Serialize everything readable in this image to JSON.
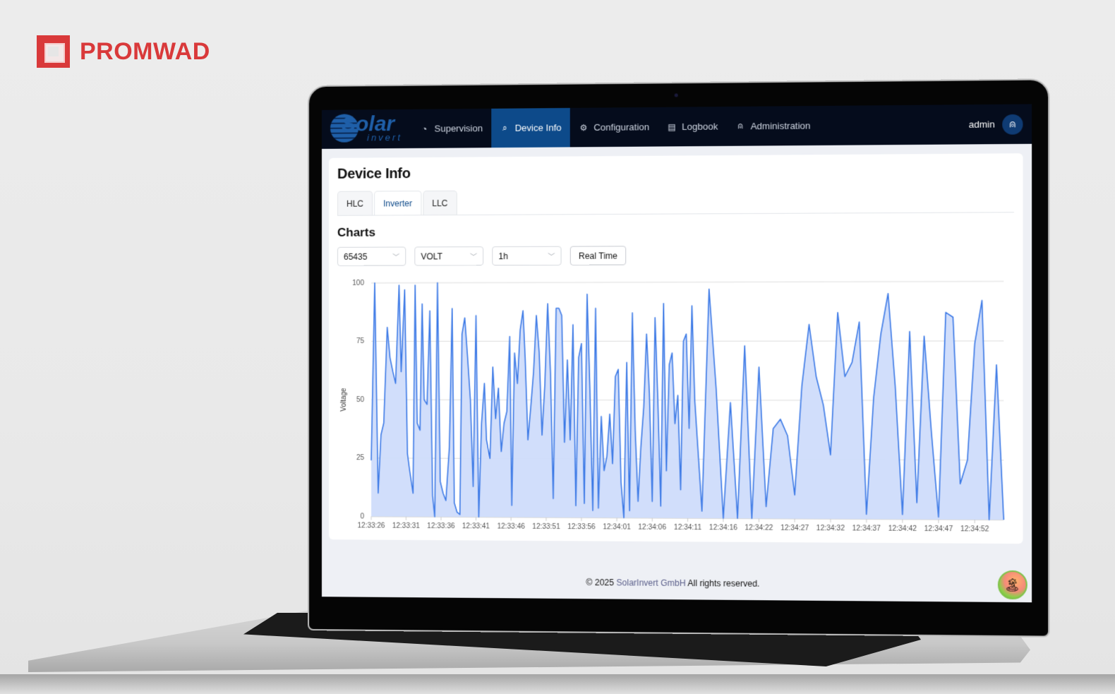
{
  "brand": {
    "name": "PROMWAD",
    "color": "#d9393a"
  },
  "app": {
    "logo": {
      "word": "Solar",
      "sub": "invert"
    },
    "nav": [
      {
        "label": "Supervision",
        "icon": "gauge-icon",
        "glyph": "◔",
        "active": false
      },
      {
        "label": "Device Info",
        "icon": "search-icon",
        "glyph": "⌕",
        "active": true
      },
      {
        "label": "Configuration",
        "icon": "gear-icon",
        "glyph": "⚙",
        "active": false
      },
      {
        "label": "Logbook",
        "icon": "logbook-icon",
        "glyph": "▤",
        "active": false
      },
      {
        "label": "Administration",
        "icon": "user-icon",
        "glyph": "⍝",
        "active": false
      }
    ],
    "user": {
      "name": "admin",
      "avatar_glyph": "⍝"
    },
    "colors": {
      "navbar": "#050c1c",
      "active_tab": "#0d4a8a",
      "series": "#3d7ae6",
      "fill": "#cfdcfb"
    }
  },
  "page": {
    "title": "Device Info",
    "tabs": [
      {
        "label": "HLC",
        "active": false
      },
      {
        "label": "Inverter",
        "active": true
      },
      {
        "label": "LLC",
        "active": false
      }
    ],
    "charts_title": "Charts",
    "controls": {
      "device": "65435",
      "metric": "VOLT",
      "range": "1h",
      "realtime_label": "Real Time"
    }
  },
  "chart_data": {
    "type": "area",
    "title": "",
    "xlabel": "",
    "ylabel": "Voltage",
    "ylim": [
      0,
      100
    ],
    "yticks": [
      0,
      25,
      50,
      75,
      100
    ],
    "grid": true,
    "legend": "none",
    "xtick_labels": [
      "12:33:26",
      "12:33:31",
      "12:33:36",
      "12:33:41",
      "12:33:46",
      "12:33:51",
      "12:33:56",
      "12:34:01",
      "12:34:06",
      "12:34:11",
      "12:34:16",
      "12:34:22",
      "12:34:27",
      "12:34:32",
      "12:34:37",
      "12:34:42",
      "12:34:47",
      "12:34:52"
    ],
    "x_start_s": 0,
    "x_end_s": 89,
    "tick_interval_s": 5,
    "series": [
      {
        "name": "Voltage",
        "t": [
          0,
          0.5,
          1,
          1.4,
          1.8,
          2.3,
          2.7,
          3.1,
          3.5,
          4,
          4.3,
          4.8,
          5.2,
          5.5,
          6,
          6.3,
          6.6,
          7,
          7.3,
          7.6,
          8,
          8.4,
          8.8,
          9.1,
          9.5,
          9.9,
          10.3,
          10.7,
          11.2,
          11.6,
          11.9,
          12.3,
          12.7,
          13,
          13.4,
          13.8,
          14.2,
          14.6,
          15,
          15.4,
          15.8,
          16.2,
          16.5,
          17,
          17.4,
          17.8,
          18.2,
          18.6,
          19,
          19.4,
          19.8,
          20.1,
          20.5,
          20.9,
          21.3,
          21.7,
          22,
          22.4,
          22.8,
          23.2,
          23.6,
          24,
          24.4,
          24.8,
          25.2,
          25.6,
          26,
          26.4,
          26.8,
          27.2,
          27.6,
          28,
          28.4,
          28.8,
          29.2,
          29.6,
          30,
          30.4,
          30.8,
          31.2,
          31.6,
          32,
          32.4,
          32.8,
          33.2,
          33.6,
          34,
          34.4,
          34.8,
          35.2,
          35.6,
          36,
          36.4,
          36.8,
          37.2,
          37.6,
          38,
          38.4,
          38.8,
          39.2,
          39.6,
          40,
          40.4,
          40.8,
          41.2,
          41.6,
          42,
          42.4,
          42.8,
          43.2,
          43.6,
          44,
          44.4,
          44.8,
          45.2,
          45.6,
          46,
          47,
          48,
          49,
          50,
          51,
          52,
          53,
          54,
          55,
          56,
          57,
          58,
          59,
          60,
          61,
          62,
          63,
          64,
          65,
          66,
          67,
          68,
          69,
          70,
          71,
          72,
          73,
          74,
          75,
          76,
          77,
          78,
          79,
          80,
          81,
          82,
          83,
          84,
          85,
          86,
          87,
          88,
          89
        ],
        "values": [
          24,
          100,
          10,
          35,
          40,
          81,
          68,
          62,
          57,
          99,
          62,
          97,
          27,
          20,
          10,
          99,
          40,
          37,
          91,
          50,
          48,
          88,
          9,
          0,
          100,
          15,
          10,
          7,
          30,
          89,
          6,
          2,
          1,
          78,
          85,
          68,
          50,
          13,
          86,
          0,
          40,
          57,
          33,
          25,
          64,
          42,
          55,
          28,
          40,
          45,
          77,
          5,
          70,
          57,
          80,
          88,
          68,
          33,
          47,
          62,
          86,
          70,
          35,
          56,
          91,
          62,
          8,
          89,
          89,
          86,
          32,
          67,
          33,
          82,
          5,
          68,
          74,
          6,
          95,
          55,
          3,
          89,
          4,
          43,
          20,
          26,
          44,
          23,
          60,
          63,
          15,
          0,
          66,
          3,
          87,
          37,
          7,
          30,
          47,
          78,
          53,
          7,
          85,
          50,
          5,
          91,
          20,
          65,
          70,
          40,
          52,
          12,
          75,
          78,
          38,
          90,
          50,
          3,
          97,
          55,
          0,
          49,
          0,
          73,
          0,
          64,
          5,
          38,
          42,
          35,
          10,
          56,
          82,
          60,
          48,
          27,
          87,
          60,
          66,
          83,
          2,
          51,
          78,
          95,
          56,
          2,
          79,
          7,
          77,
          37,
          1,
          87,
          85,
          15,
          25,
          74,
          92,
          0,
          65,
          0,
          70,
          0,
          96,
          65,
          45
        ],
        "color": "#3d7ae6"
      }
    ]
  },
  "footer": {
    "prefix": "© 2025 ",
    "company": "SolarInvert GmbH",
    "suffix": " All rights reserved."
  },
  "help_badge": {
    "glyph": "🏝"
  }
}
